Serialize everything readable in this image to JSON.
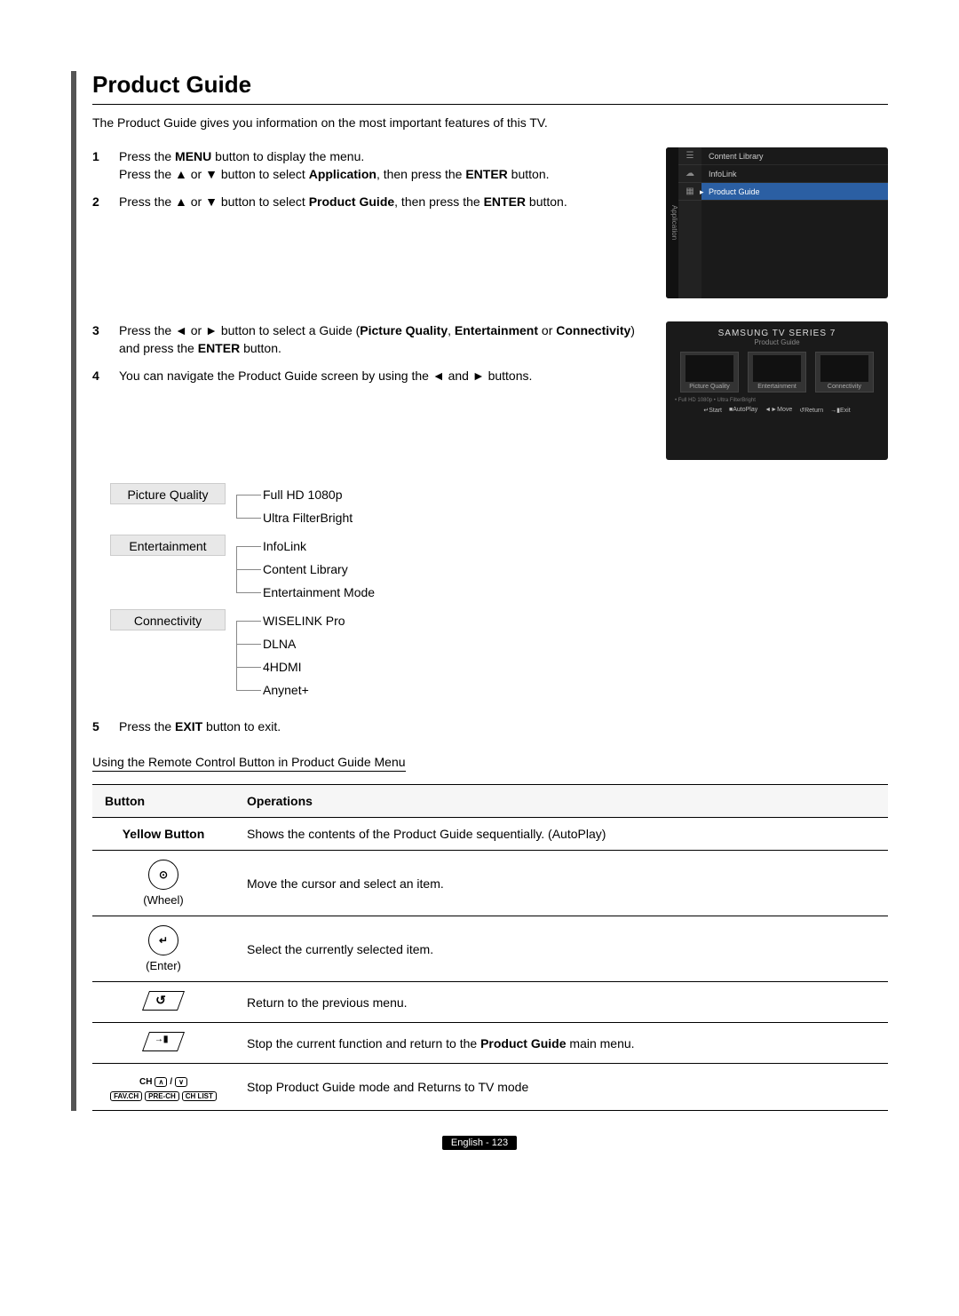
{
  "title": "Product Guide",
  "intro": "The Product Guide gives you information on the most important features of this TV.",
  "stepsA": [
    {
      "num": "1",
      "html": "Press the <b>MENU</b> button to display the menu.<br>Press the ▲ or ▼ button to select <b>Application</b>, then press the <b>ENTER</b> button."
    },
    {
      "num": "2",
      "html": "Press the ▲ or ▼ button to select <b>Product Guide</b>, then press the <b>ENTER</b> button."
    }
  ],
  "stepsB": [
    {
      "num": "3",
      "html": "Press the ◄ or ► button to select a Guide (<b>Picture Quality</b>, <b>Entertainment</b> or <b>Connectivity</b>) and press the <b>ENTER</b> button."
    },
    {
      "num": "4",
      "html": "You can navigate the Product Guide screen by using the ◄ and ► buttons."
    }
  ],
  "step5": {
    "num": "5",
    "html": "Press the <b>EXIT</b> button to exit."
  },
  "menu1": {
    "vtab": "Application",
    "items": [
      "Content Library",
      "InfoLink",
      "Product Guide"
    ],
    "selected": 2
  },
  "pg": {
    "brand": "SAMSUNG TV SERIES 7",
    "sub": "Product Guide",
    "cards": [
      "Picture Quality",
      "Entertainment",
      "Connectivity"
    ],
    "note": "• Full HD 1080p  • Ultra FilterBright",
    "hints": [
      "↵Start",
      "■AutoPlay",
      "◄►Move",
      "↺Return",
      "→▮Exit"
    ]
  },
  "tree": [
    {
      "head": "Picture Quality",
      "items": [
        "Full HD 1080p",
        "Ultra FilterBright"
      ]
    },
    {
      "head": "Entertainment",
      "items": [
        "InfoLink",
        "Content Library",
        "Entertainment Mode"
      ]
    },
    {
      "head": "Connectivity",
      "items": [
        "WISELINK Pro",
        "DLNA",
        "4HDMI",
        "Anynet+"
      ]
    }
  ],
  "subhead": "Using the Remote Control Button in Product Guide Menu",
  "table": {
    "headers": [
      "Button",
      "Operations"
    ],
    "rows": [
      {
        "btn": "Yellow Button",
        "btnType": "text",
        "op": "Shows the contents of the Product Guide sequentially. (AutoPlay)"
      },
      {
        "btn": "(Wheel)",
        "btnType": "wheel",
        "op": "Move the cursor and select an item."
      },
      {
        "btn": "(Enter)",
        "btnType": "enter",
        "op": "Select the currently selected item."
      },
      {
        "btn": "",
        "btnType": "return",
        "op": "Return to the previous menu."
      },
      {
        "btn": "",
        "btnType": "exit",
        "op_html": "Stop the current function and return to the <b>Product Guide</b> main menu."
      },
      {
        "btn": "",
        "btnType": "ch",
        "op": "Stop Product Guide mode and Returns to TV mode"
      }
    ],
    "ch_keys": [
      "FAV.CH",
      "PRE-CH",
      "CH LIST"
    ]
  },
  "footer": "English - 123"
}
